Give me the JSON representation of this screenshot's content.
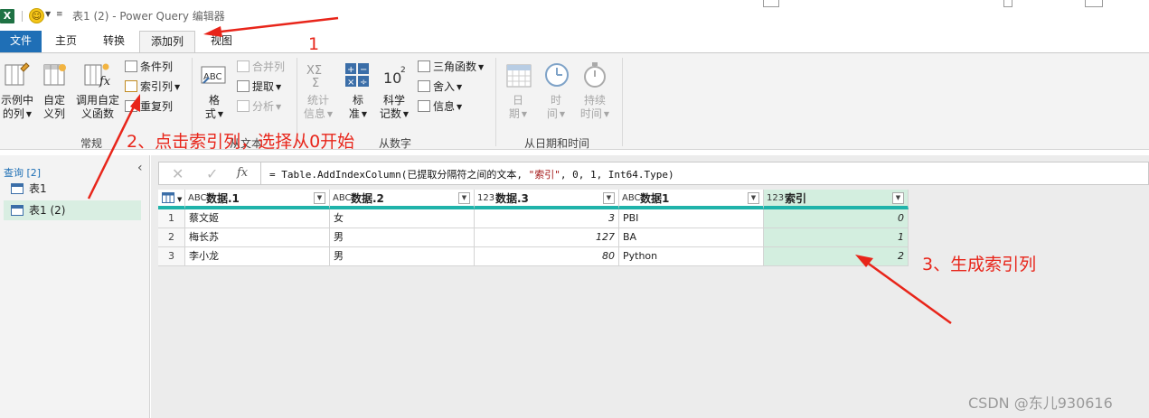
{
  "window": {
    "app_logo": "X",
    "title": "表1 (2) - Power Query 编辑器"
  },
  "tabs": {
    "file": "文件",
    "home": "主页",
    "transform": "转换",
    "add_column": "添加列",
    "view": "视图"
  },
  "ribbon": {
    "general": {
      "col_from_examples_l1": "示例中",
      "col_from_examples_l2": "的列",
      "custom_col_l1": "自定",
      "custom_col_l2": "义列",
      "invoke_fn_l1": "调用自定",
      "invoke_fn_l2": "义函数",
      "conditional_col": "条件列",
      "index_col": "索引列",
      "duplicate_col": "重复列",
      "group_label": "常规"
    },
    "from_text": {
      "format_l1": "格",
      "format_l2": "式",
      "merge_cols": "合并列",
      "extract": "提取",
      "parse": "分析",
      "group_label": "从文本"
    },
    "from_number": {
      "statistics_l1": "统计",
      "statistics_l2": "信息",
      "standard_l1": "标",
      "standard_l2": "准",
      "scientific_l1": "科学",
      "scientific_l2": "记数",
      "trig": "三角函数",
      "rounding": "舍入",
      "information": "信息",
      "group_label": "从数字"
    },
    "from_datetime": {
      "date_l1": "日",
      "date_l2": "期",
      "time_l1": "时",
      "time_l2": "间",
      "duration_l1": "持续",
      "duration_l2": "时间",
      "group_label": "从日期和时间"
    }
  },
  "queries": {
    "header": "查询 [2]",
    "items": [
      {
        "label": "表1"
      },
      {
        "label": "表1 (2)",
        "selected": true
      }
    ]
  },
  "formula": {
    "prefix": "= Table.AddIndexColumn(已提取分隔符之间的文本, ",
    "str_arg": "\"索引\"",
    "rest": ", 0, 1, Int64.Type)"
  },
  "grid": {
    "columns": [
      {
        "type": "ABC",
        "name": "数据.1"
      },
      {
        "type": "ABC",
        "name": "数据.2"
      },
      {
        "type": "123",
        "name": "数据.3"
      },
      {
        "type": "ABC",
        "name": "数据1"
      },
      {
        "type": "123",
        "name": "索引"
      }
    ],
    "rows": [
      [
        "1",
        "蔡文姬",
        "女",
        "3",
        "PBI",
        "0"
      ],
      [
        "2",
        "梅长苏",
        "男",
        "127",
        "BA",
        "1"
      ],
      [
        "3",
        "李小龙",
        "男",
        "80",
        "Python",
        "2"
      ]
    ]
  },
  "annotations": {
    "step1": "1",
    "step2": "2、点击索引列，选择从0开始",
    "step3": "3、生成索引列"
  },
  "watermark": "CSDN @东儿930616",
  "colors": {
    "file_tab": "#1f6fb6",
    "header_stripe": "#1fb3aa",
    "selected_col": "#d3eedf",
    "annotation": "#e8251a"
  }
}
